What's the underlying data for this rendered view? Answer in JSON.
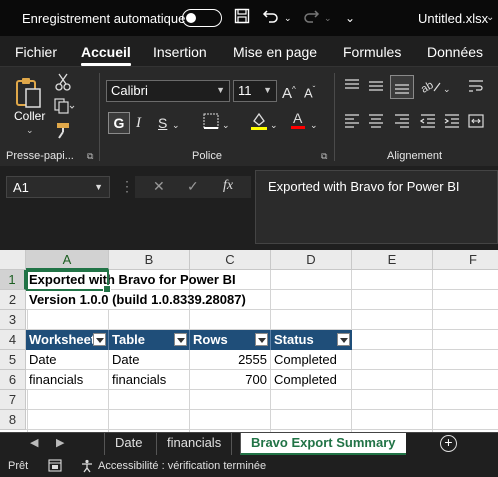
{
  "titlebar": {
    "autosave_label": "Enregistrement automatique",
    "filename": "Untitled.xlsx"
  },
  "tabs": [
    "Fichier",
    "Accueil",
    "Insertion",
    "Mise en page",
    "Formules",
    "Données"
  ],
  "ribbon": {
    "clipboard": {
      "paste_label": "Coller",
      "group_label": "Presse-papi..."
    },
    "font": {
      "name": "Calibri",
      "size": "11",
      "group_label": "Police",
      "bold": "G",
      "italic": "I",
      "underline": "S"
    },
    "alignment": {
      "group_label": "Alignement"
    }
  },
  "formula_bar": {
    "name_box": "A1",
    "fx_label": "fx",
    "formula": "Exported with Bravo for Power BI"
  },
  "grid": {
    "columns": [
      "A",
      "B",
      "C",
      "D",
      "E",
      "F"
    ],
    "rows": [
      "1",
      "2",
      "3",
      "4",
      "5",
      "6",
      "7",
      "8"
    ],
    "title": "Exported with Bravo for Power BI",
    "version": "Version 1.0.0 (build 1.0.8339.28087)",
    "table_headers": [
      "Worksheet",
      "Table",
      "Rows",
      "Status"
    ],
    "table_rows": [
      [
        "Date",
        "Date",
        "2555",
        "Completed"
      ],
      [
        "financials",
        "financials",
        "700",
        "Completed"
      ]
    ]
  },
  "sheets": {
    "tabs": [
      "Date",
      "financials",
      "Bravo Export Summary"
    ],
    "active": "Bravo Export Summary"
  },
  "status": {
    "ready": "Prêt",
    "accessibility": "Accessibilité : vérification terminée"
  }
}
